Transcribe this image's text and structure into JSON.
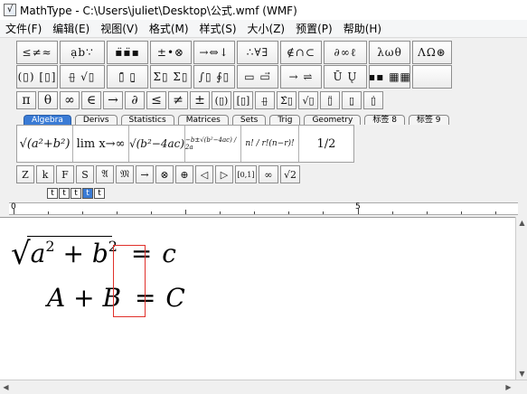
{
  "window": {
    "title": "MathType - C:\\Users\\juliet\\Desktop\\公式.wmf (WMF)"
  },
  "menu": [
    "文件(F)",
    "编辑(E)",
    "视图(V)",
    "格式(M)",
    "样式(S)",
    "大小(Z)",
    "预置(P)",
    "帮助(H)"
  ],
  "palette_row1": [
    "≤≠≈",
    "ạb∵",
    "▪̈▪̈▪",
    "±•⊗",
    "→⇔↓",
    "∴∀∃",
    "∉∩⊂",
    "∂∞ℓ",
    "λωθ",
    "ΛΩ⊛"
  ],
  "palette_row2": [
    "(▯) [▯]",
    "▯̶ √▯",
    "▯̄ ▯̱",
    "Σ▯ Σ▯",
    "∫▯ ∮▯",
    "▭ ▭⃗",
    "→ ⇌",
    "Ū Ų",
    "▪▪ ▦▦",
    ""
  ],
  "symbol_row": [
    "π",
    "θ",
    "∞",
    "∈",
    "→",
    "∂",
    "≤",
    "≠",
    "±",
    "(▯)",
    "[▯]",
    "▯̶",
    "Σ̇▯",
    "√▯",
    "▯̈",
    "▯̱",
    "▯̇"
  ],
  "tabs": [
    "Algebra",
    "Derivs",
    "Statistics",
    "Matrices",
    "Sets",
    "Trig",
    "Geometry",
    "标签 8",
    "标签 9"
  ],
  "active_tab": "Algebra",
  "templates": [
    "√(a²+b²)",
    "lim x→∞",
    "√(b²−4ac)",
    "−b±√(b²−4ac) / 2a",
    "n! / r!(n−r)!",
    "1/2"
  ],
  "style_row": [
    "Z",
    "k",
    "F",
    "S",
    "𝔄",
    "𝔐",
    "→",
    "⊗",
    "⊕",
    "◁",
    "▷",
    "[0,1]",
    "∞",
    "√2"
  ],
  "size_buttons": [
    "t",
    "t",
    "t",
    "t",
    "t"
  ],
  "ruler": {
    "mark_0": "0",
    "mark_5": "5"
  },
  "equation": {
    "line1_sqrt_content": "a",
    "line1_sup1": "2",
    "line1_plus": " + ",
    "line1_b": "b",
    "line1_sup2": "2",
    "line1_eq": "=",
    "line1_rhs": "c",
    "line2_lhs": "A + B",
    "line2_eq": "=",
    "line2_rhs": "C"
  },
  "colors": {
    "selection_box": "#e0302a",
    "active_tab": "#3a7bd5"
  }
}
